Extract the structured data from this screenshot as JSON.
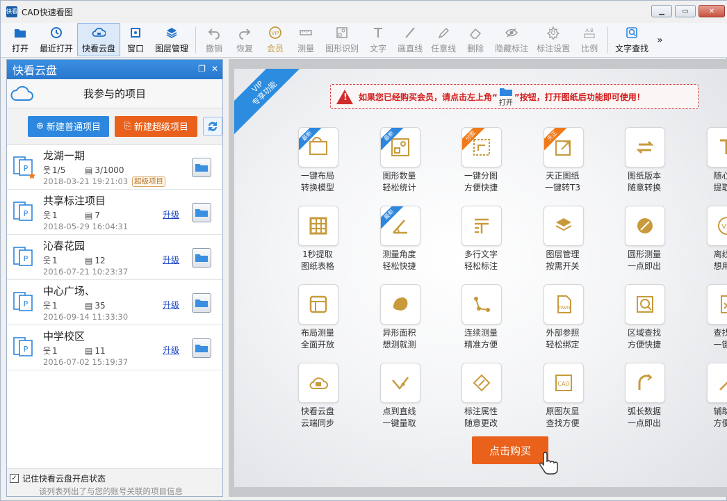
{
  "window": {
    "title": "CAD快速看图",
    "app_icon_text": "快看"
  },
  "toolbar": {
    "items": [
      {
        "label": "打开",
        "icon": "open-folder-icon",
        "state": "enabled"
      },
      {
        "label": "最近打开",
        "icon": "recent-clock-icon",
        "state": "enabled"
      },
      {
        "label": "快看云盘",
        "icon": "cloud-drive-icon",
        "state": "active"
      },
      {
        "label": "窗口",
        "icon": "window-icon",
        "state": "enabled"
      },
      {
        "label": "图层管理",
        "icon": "layers-icon",
        "state": "enabled"
      },
      {
        "label": "撤销",
        "icon": "undo-icon",
        "state": "disabled"
      },
      {
        "label": "恢复",
        "icon": "redo-icon",
        "state": "disabled"
      },
      {
        "label": "会员",
        "icon": "vip-icon",
        "state": "vip"
      },
      {
        "label": "测量",
        "icon": "ruler-icon",
        "state": "disabled"
      },
      {
        "label": "图形识别",
        "icon": "shape-recognize-icon",
        "state": "disabled"
      },
      {
        "label": "文字",
        "icon": "text-icon",
        "state": "disabled"
      },
      {
        "label": "画直线",
        "icon": "line-icon",
        "state": "disabled"
      },
      {
        "label": "任意线",
        "icon": "freehand-pen-icon",
        "state": "disabled"
      },
      {
        "label": "删除",
        "icon": "eraser-icon",
        "state": "disabled"
      },
      {
        "label": "隐藏标注",
        "icon": "hide-eye-icon",
        "state": "disabled"
      },
      {
        "label": "标注设置",
        "icon": "annotation-settings-icon",
        "state": "disabled"
      },
      {
        "label": "比例",
        "icon": "scale-ratio-icon",
        "state": "disabled"
      },
      {
        "label": "文字查找",
        "icon": "text-search-icon",
        "state": "enabled"
      }
    ],
    "more": "»"
  },
  "panel": {
    "title": "快看云盘",
    "section_title": "我参与的项目",
    "new_normal": "新建普通项目",
    "new_super": "新建超级项目",
    "projects": [
      {
        "name": "龙湖一期",
        "members": "1/5",
        "files": "3/1000",
        "date": "2018-03-21 19:21:03",
        "tag": "超级项目",
        "upgrade": "",
        "starred": true
      },
      {
        "name": "共享标注项目",
        "members": "1",
        "files": "7",
        "date": "2018-05-29 16:04:31",
        "tag": "",
        "upgrade": "升级",
        "starred": false
      },
      {
        "name": "沁春花园",
        "members": "1",
        "files": "12",
        "date": "2016-07-21 10:23:37",
        "tag": "",
        "upgrade": "升级",
        "starred": false
      },
      {
        "name": "中心广场、",
        "members": "1",
        "files": "35",
        "date": "2016-09-14 11:33:30",
        "tag": "",
        "upgrade": "升级",
        "starred": false
      },
      {
        "name": "中学校区",
        "members": "1",
        "files": "11",
        "date": "2016-07-02 15:19:37",
        "tag": "",
        "upgrade": "升级",
        "starred": false
      }
    ],
    "remember_label": "记住快看云盘开启状态",
    "remember_checked": true,
    "footer_note": "该列表列出了与您的账号关联的项目信息"
  },
  "vip": {
    "ribbon_line1": "VIP",
    "ribbon_line2": "专享功能",
    "notice_before": "如果您已经购买会员，请点击左上角“",
    "notice_open": "打开",
    "notice_after": "”按钮，打开图纸后功能即可使用！",
    "features": [
      {
        "l1": "一键布局",
        "l2": "转换模型",
        "icon": "layout-convert-icon",
        "badge": "最新",
        "badge_color": "blue"
      },
      {
        "l1": "图形数量",
        "l2": "轻松统计",
        "icon": "shape-count-icon",
        "badge": "最新",
        "badge_color": "blue"
      },
      {
        "l1": "一键分图",
        "l2": "方便快捷",
        "icon": "split-drawing-icon",
        "badge": "分图",
        "badge_color": "orange"
      },
      {
        "l1": "天正图纸",
        "l2": "一键转T3",
        "icon": "export-t3-icon",
        "badge": "天正",
        "badge_color": "orange"
      },
      {
        "l1": "图纸版本",
        "l2": "随意转换",
        "icon": "version-convert-icon",
        "badge": "",
        "badge_color": ""
      },
      {
        "l1": "随心所",
        "l2": "提取文",
        "icon": "text-extract-icon",
        "badge": "",
        "badge_color": ""
      },
      {
        "l1": "1秒提取",
        "l2": "图纸表格",
        "icon": "table-extract-icon",
        "badge": "",
        "badge_color": ""
      },
      {
        "l1": "测量角度",
        "l2": "轻松快捷",
        "icon": "angle-measure-icon",
        "badge": "最新",
        "badge_color": "blue"
      },
      {
        "l1": "多行文字",
        "l2": "轻松标注",
        "icon": "multiline-text-icon",
        "badge": "",
        "badge_color": ""
      },
      {
        "l1": "图层管理",
        "l2": "按需开关",
        "icon": "layer-manage-icon",
        "badge": "",
        "badge_color": ""
      },
      {
        "l1": "圆形测量",
        "l2": "一点即出",
        "icon": "circle-measure-icon",
        "badge": "",
        "badge_color": ""
      },
      {
        "l1": "离线VI",
        "l2": "想用就",
        "icon": "offline-vip-icon",
        "badge": "",
        "badge_color": ""
      },
      {
        "l1": "布局测量",
        "l2": "全面开放",
        "icon": "layout-measure-icon",
        "badge": "",
        "badge_color": ""
      },
      {
        "l1": "异形面积",
        "l2": "想测就测",
        "icon": "irregular-area-icon",
        "badge": "",
        "badge_color": ""
      },
      {
        "l1": "连续测量",
        "l2": "精准方便",
        "icon": "continuous-measure-icon",
        "badge": "",
        "badge_color": ""
      },
      {
        "l1": "外部参照",
        "l2": "轻松绑定",
        "icon": "xref-dwg-icon",
        "badge": "",
        "badge_color": ""
      },
      {
        "l1": "区域查找",
        "l2": "方便快捷",
        "icon": "area-search-icon",
        "badge": "",
        "badge_color": ""
      },
      {
        "l1": "查找结",
        "l2": "一键导",
        "icon": "export-excel-icon",
        "badge": "",
        "badge_color": ""
      },
      {
        "l1": "快看云盘",
        "l2": "云端同步",
        "icon": "cloud-sync-icon",
        "badge": "",
        "badge_color": ""
      },
      {
        "l1": "点到直线",
        "l2": "一键量取",
        "icon": "point-to-line-icon",
        "badge": "",
        "badge_color": ""
      },
      {
        "l1": "标注属性",
        "l2": "随意更改",
        "icon": "annotation-edit-icon",
        "badge": "",
        "badge_color": ""
      },
      {
        "l1": "原图灰显",
        "l2": "查找方便",
        "icon": "gray-cad-icon",
        "badge": "",
        "badge_color": ""
      },
      {
        "l1": "弧长数据",
        "l2": "一点即出",
        "icon": "arc-length-icon",
        "badge": "",
        "badge_color": ""
      },
      {
        "l1": "辅助直",
        "l2": "方便简",
        "icon": "aux-line-icon",
        "badge": "",
        "badge_color": ""
      }
    ],
    "buy_label": "点击购买",
    "accent_gold": "#c89a3c",
    "accent_orange": "#e9611a",
    "accent_blue": "#2d87de"
  }
}
